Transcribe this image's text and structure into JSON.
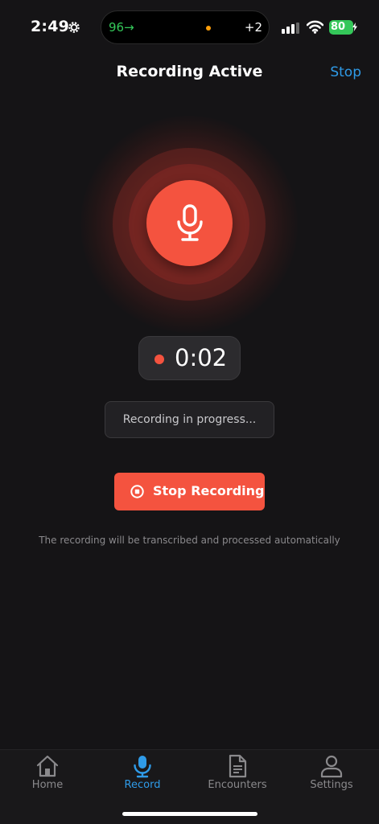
{
  "status_bar": {
    "time": "2:49",
    "island_left": "96→",
    "island_right": "+2",
    "battery": "80"
  },
  "header": {
    "title": "Recording Active",
    "stop_link": "Stop"
  },
  "recorder": {
    "timer": "0:02",
    "status": "Recording in progress...",
    "stop_button_label": "Stop Recording",
    "note": "The recording will be transcribed and processed automatically"
  },
  "tabs": [
    {
      "label": "Home",
      "icon": "home-icon",
      "active": false
    },
    {
      "label": "Record",
      "icon": "microphone-icon",
      "active": true
    },
    {
      "label": "Encounters",
      "icon": "document-icon",
      "active": false
    },
    {
      "label": "Settings",
      "icon": "person-icon",
      "active": false
    }
  ],
  "colors": {
    "accent_red": "#f4533f",
    "link_blue": "#2f9be8",
    "background": "#151416",
    "battery_green": "#34c759"
  }
}
